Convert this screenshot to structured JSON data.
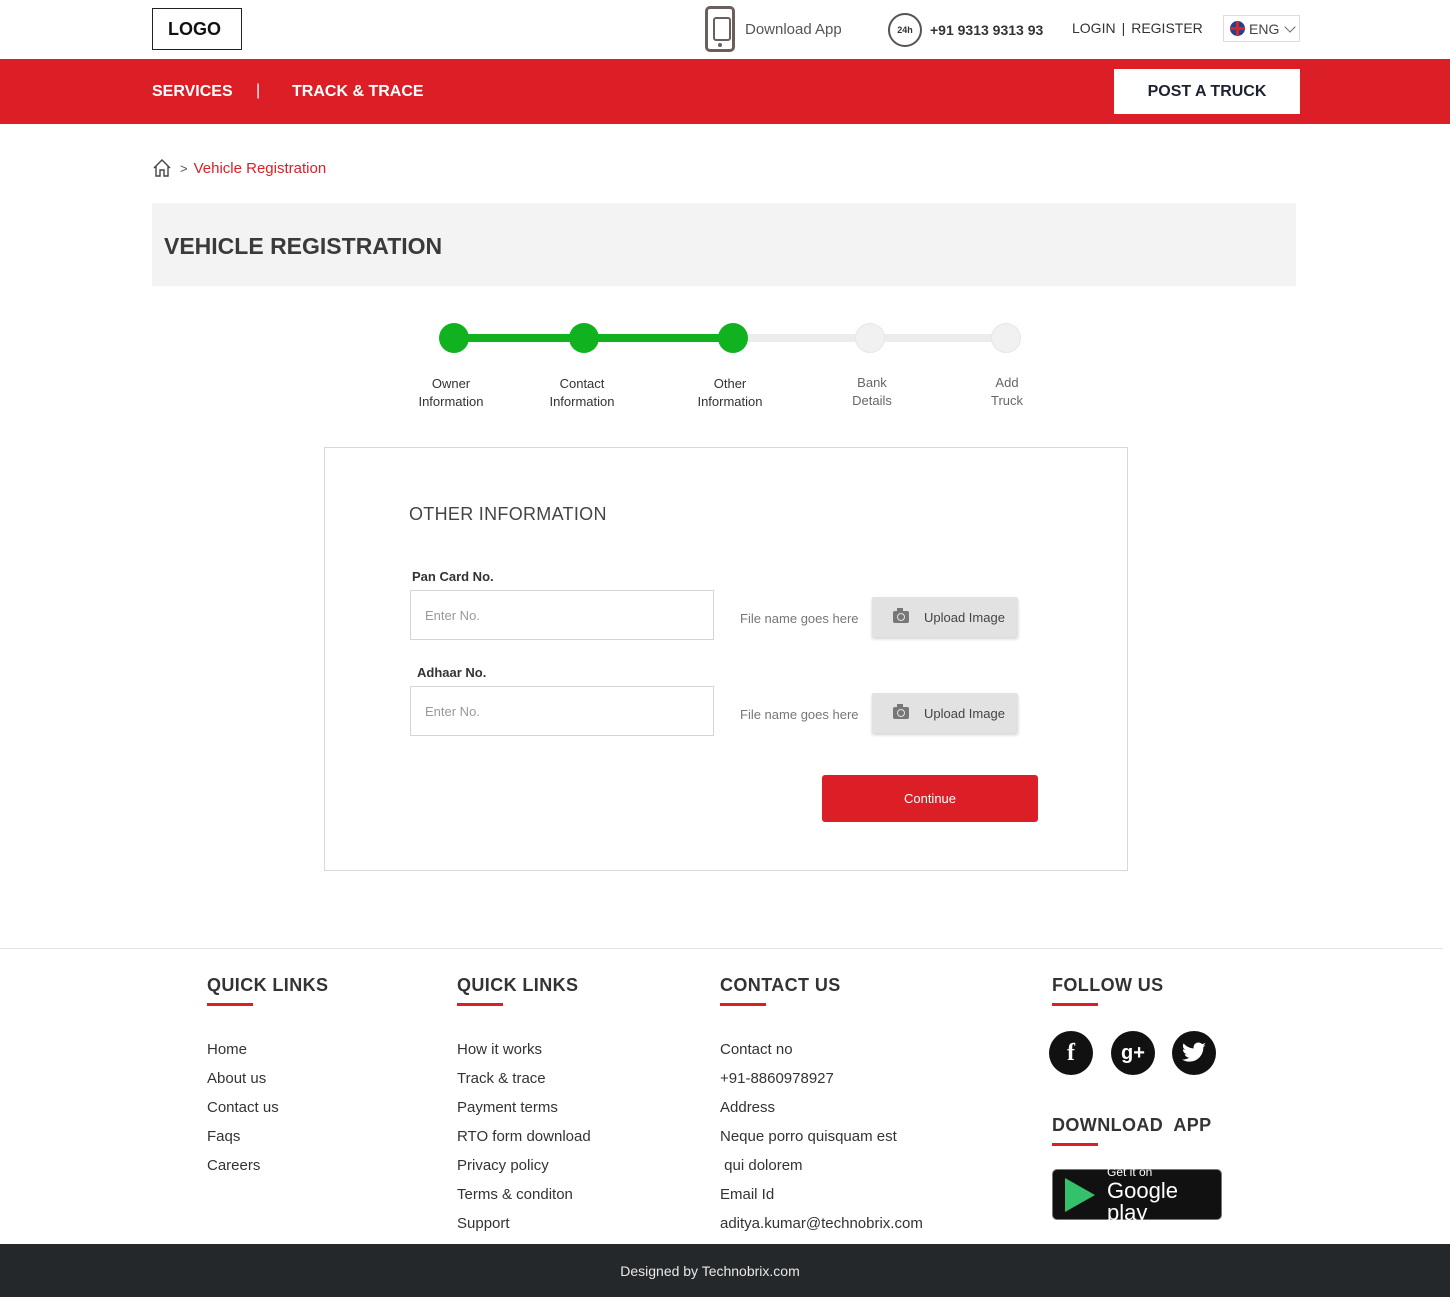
{
  "header": {
    "logo": "LOGO",
    "download_app": "Download App",
    "support_badge": "24h",
    "phone": "+91 9313 9313 93",
    "login": "LOGIN",
    "separator": "|",
    "register": "REGISTER",
    "language": "ENG"
  },
  "nav": {
    "services": "SERVICES",
    "separator": "|",
    "track_trace": "TRACK & TRACE",
    "post_truck": "POST A TRUCK"
  },
  "breadcrumb": {
    "separator": ">",
    "current": "Vehicle Registration"
  },
  "page_title": "VEHICLE REGISTRATION",
  "stepper": {
    "steps": [
      {
        "line1": "Owner",
        "line2": "Information",
        "status": "done"
      },
      {
        "line1": "Contact",
        "line2": "Information",
        "status": "done"
      },
      {
        "line1": "Other",
        "line2": "Information",
        "status": "done"
      },
      {
        "line1": "Bank",
        "line2": "Details",
        "status": "todo"
      },
      {
        "line1": "Add",
        "line2": "Truck",
        "status": "todo"
      }
    ]
  },
  "form": {
    "title": "OTHER INFORMATION",
    "pan": {
      "label": "Pan Card No.",
      "placeholder": "Enter No.",
      "file_name": "File name goes here",
      "upload": "Upload Image"
    },
    "adhaar": {
      "label": "Adhaar No.",
      "placeholder": "Enter No.",
      "file_name": "File name goes here",
      "upload": "Upload Image"
    },
    "continue": "Continue"
  },
  "footer": {
    "quick_links_1": {
      "title": "QUICK LINKS",
      "items": [
        "Home",
        "About us",
        "Contact us",
        "Faqs",
        "Careers"
      ]
    },
    "quick_links_2": {
      "title": "QUICK LINKS",
      "items": [
        "How it works",
        "Track & trace",
        "Payment terms",
        "RTO form download",
        "Privacy policy",
        "Terms & conditon",
        "Support"
      ]
    },
    "contact": {
      "title": "CONTACT US",
      "items": [
        "Contact no",
        "+91-8860978927",
        "Address",
        "Neque porro quisquam est",
        " qui dolorem",
        "Email Id",
        "aditya.kumar@technobrix.com"
      ]
    },
    "follow": {
      "title": "FOLLOW US",
      "facebook": "f",
      "google_plus": "g+",
      "twitter": "t"
    },
    "download": {
      "title": "DOWNLOAD  APP",
      "get_it_on": "Get it on",
      "store": "Google play"
    },
    "credit": "Designed by Technobrix.com"
  },
  "colors": {
    "brand_red": "#dc1f26",
    "step_done": "#10b31f",
    "step_todo": "#f1f1f1",
    "footer_bar": "#25282b"
  }
}
